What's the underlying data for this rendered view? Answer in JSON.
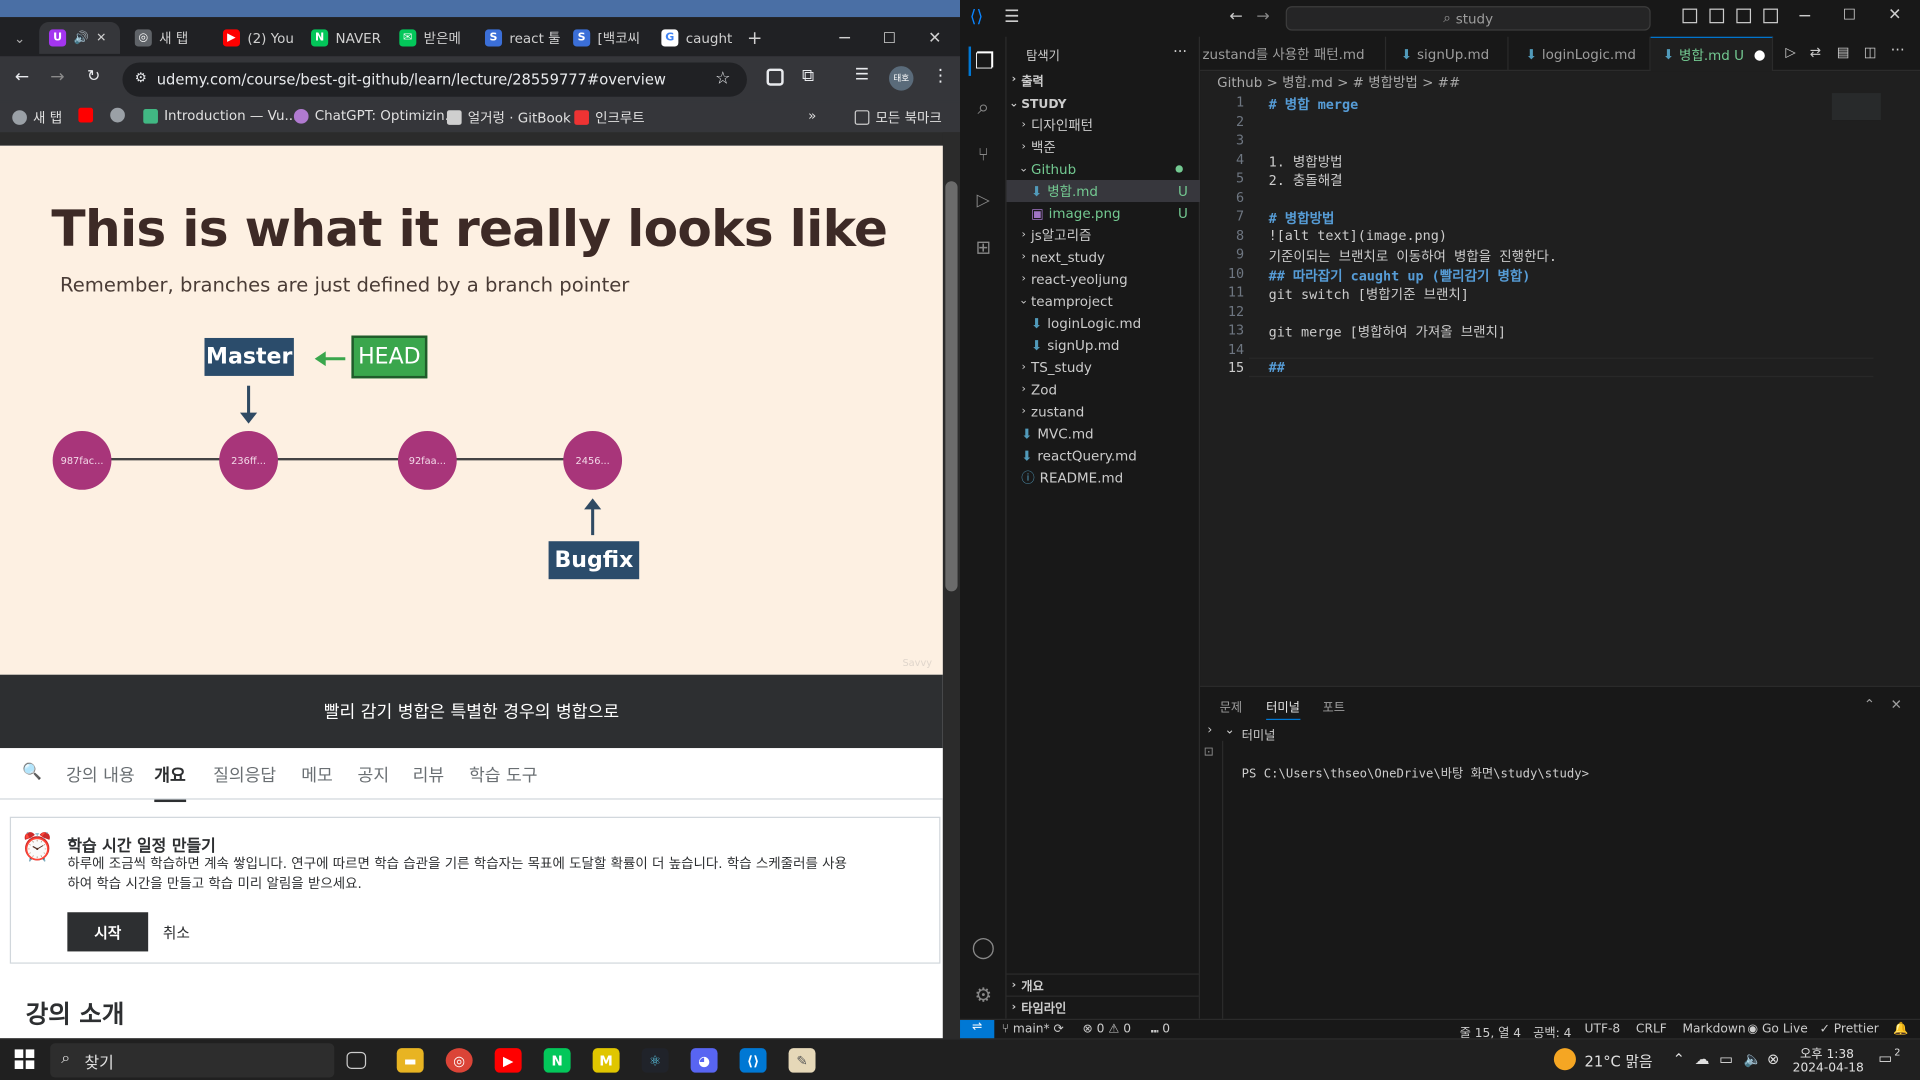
{
  "chrome": {
    "tabs": [
      {
        "label": "",
        "icon": "udemy"
      },
      {
        "label": "새 탭",
        "icon": "chrome"
      },
      {
        "label": "(2) You",
        "icon": "youtube"
      },
      {
        "label": "NAVER",
        "icon": "naver"
      },
      {
        "label": "받은메",
        "icon": "mail"
      },
      {
        "label": "react 툴",
        "icon": "s-blue"
      },
      {
        "label": "[백코씨",
        "icon": "s-blue"
      },
      {
        "label": "caught",
        "icon": "google"
      }
    ],
    "url": "udemy.com/course/best-git-github/learn/lecture/28559777#overview",
    "profile": "태호",
    "bookmarks": [
      "새 탭",
      "",
      "",
      "Introduction — Vu...",
      "ChatGPT: Optimizin...",
      "얼거렁 · GitBook",
      "인크루트"
    ],
    "bookmarks_all": "모든 북마크"
  },
  "slide": {
    "title": "This is what it really looks like",
    "subtitle": "Remember, branches are just defined by a branch pointer",
    "master": "Master",
    "head": "HEAD",
    "bugfix": "Bugfix",
    "commits": [
      "987fac...",
      "236ff...",
      "92faa...",
      "2456..."
    ],
    "watermark": "Savvy"
  },
  "udemy": {
    "caption": "빨리 감기 병합은 특별한 경우의 병합으로",
    "tabs": [
      "강의 내용",
      "개요",
      "질의응답",
      "메모",
      "공지",
      "리뷰",
      "학습 도구"
    ],
    "schedule_title": "학습 시간 일정 만들기",
    "schedule_desc": "하루에 조금씩 학습하면 계속 쌓입니다. 연구에 따르면 학습 습관을 기른 학습자는 목표에 도달할 확률이 더 높습니다. 학습 스케줄러를 사용하여 학습 시간을 만들고 학습 미리 알림을 받으세요.",
    "start": "시작",
    "cancel": "취소",
    "intro": "강의 소개"
  },
  "vscode": {
    "search": "study",
    "explorer_title": "탐색기",
    "output": "출력",
    "root": "STUDY",
    "tree": [
      {
        "label": "디자인패턴",
        "type": "folder"
      },
      {
        "label": "백준",
        "type": "folder"
      },
      {
        "label": "Github",
        "type": "folder-open"
      },
      {
        "label": "병합.md",
        "type": "md",
        "badge": "U"
      },
      {
        "label": "image.png",
        "type": "img",
        "badge": "U"
      },
      {
        "label": "js알고리즘",
        "type": "folder"
      },
      {
        "label": "next_study",
        "type": "folder"
      },
      {
        "label": "react-yeoljung",
        "type": "folder"
      },
      {
        "label": "teamproject",
        "type": "folder-open"
      },
      {
        "label": "loginLogic.md",
        "type": "md"
      },
      {
        "label": "signUp.md",
        "type": "md"
      },
      {
        "label": "TS_study",
        "type": "folder"
      },
      {
        "label": "Zod",
        "type": "folder"
      },
      {
        "label": "zustand",
        "type": "folder"
      },
      {
        "label": "MVC.md",
        "type": "md"
      },
      {
        "label": "reactQuery.md",
        "type": "md"
      },
      {
        "label": "README.md",
        "type": "info"
      }
    ],
    "outline": "개요",
    "timeline": "타임라인",
    "editor_tabs": [
      "zustand를 사용한 패턴.md",
      "signUp.md",
      "loginLogic.md",
      "병합.md U"
    ],
    "breadcrumb": "Github > 병합.md > # 병합방법 > ##",
    "lines": [
      "# 병합 merge",
      "",
      "",
      "1. 병합방법",
      "2. 충돌해결",
      "",
      "# 병합방법",
      "![alt text](image.png)",
      "기준이되는 브랜치로 이동하여 병합을 진행한다.",
      "## 따라잡기 caught up (빨리감기 병합)",
      "git switch [병합기준 브랜치]",
      "",
      "git merge [병합하여 가져올 브랜치]",
      "",
      "##"
    ],
    "panel_tabs": [
      "문제",
      "터미널",
      "포트"
    ],
    "terminal_label": "터미널",
    "prompt": "PS C:\\Users\\thseo\\OneDrive\\바탕 화면\\study\\study>",
    "status": {
      "branch": "main*",
      "errors": "0",
      "warnings": "0",
      "ports": "0",
      "position": "줄 15, 열 4",
      "spaces": "공백: 4",
      "encoding": "UTF-8",
      "eol": "CRLF",
      "language": "Markdown",
      "golive": "Go Live",
      "prettier": "Prettier"
    }
  },
  "taskbar": {
    "search": "찾기",
    "weather": "21°C 맑음",
    "time": "오후 1:38",
    "date": "2024-04-18",
    "notifications": "2"
  }
}
